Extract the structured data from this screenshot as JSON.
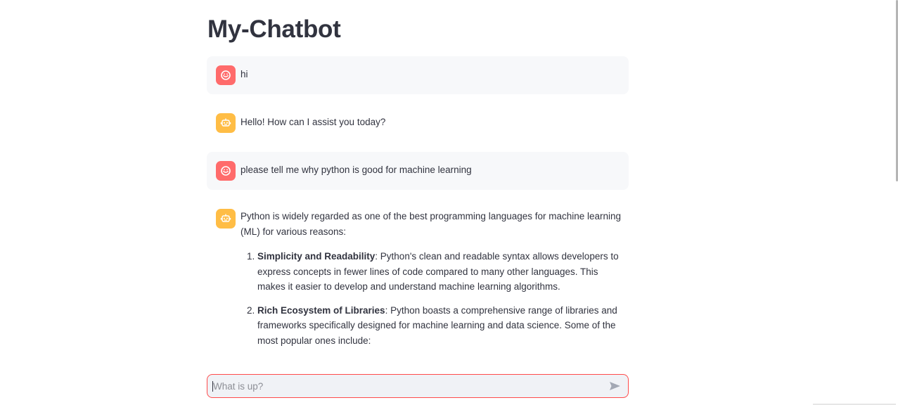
{
  "app": {
    "title": "My-Chatbot"
  },
  "colors": {
    "user_avatar": "#ff6b6b",
    "assistant_avatar": "#ffbd45",
    "input_border": "#ff4b4b",
    "user_bubble": "#f7f8fa"
  },
  "messages": [
    {
      "role": "user",
      "avatar_icon": "smiley-face-icon",
      "text": "hi"
    },
    {
      "role": "assistant",
      "avatar_icon": "robot-icon",
      "text": "Hello! How can I assist you today?"
    },
    {
      "role": "user",
      "avatar_icon": "smiley-face-icon",
      "text": "please tell me why python is good for machine learning"
    },
    {
      "role": "assistant",
      "avatar_icon": "robot-icon",
      "intro": "Python is widely regarded as one of the best programming languages for machine learning (ML) for various reasons:",
      "points": [
        {
          "title": "Simplicity and Readability",
          "text": ": Python's clean and readable syntax allows developers to express concepts in fewer lines of code compared to many other languages. This makes it easier to develop and understand machine learning algorithms."
        },
        {
          "title": "Rich Ecosystem of Libraries",
          "text": ": Python boasts a comprehensive range of libraries and frameworks specifically designed for machine learning and data science. Some of the most popular ones include:"
        }
      ]
    }
  ],
  "chat_input": {
    "placeholder": "What is up?",
    "value": "",
    "send_icon": "send-arrow-icon"
  }
}
